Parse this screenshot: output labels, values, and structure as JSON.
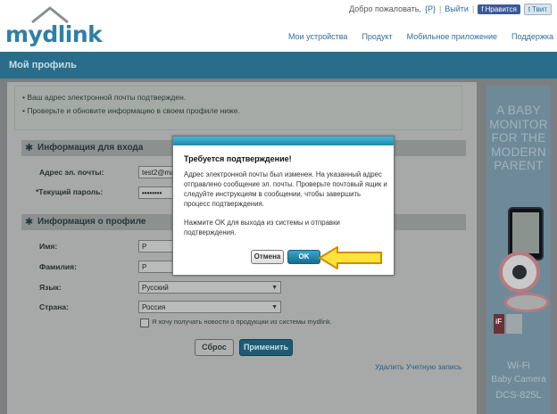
{
  "header": {
    "logo_text": "mydlink",
    "welcome": "Добро пожаловать,",
    "user": "{P}",
    "logout": "Выйти",
    "facebook": "Нравится",
    "twitter": "Твит",
    "nav": [
      "Мои устройства",
      "Продукт",
      "Мобильное приложение",
      "Поддержка"
    ]
  },
  "page": {
    "title": "Мой профиль"
  },
  "notice": {
    "line1": "Ваш адрес электронной почты подтвержден.",
    "line2": "Проверьте и обновите информацию в своем профиле ниже."
  },
  "login_section": {
    "heading": "Информация для входа",
    "email_label": "Адрес эл. почты:",
    "email_value": "test2@ma",
    "password_label": "*Текущий пароль:",
    "password_value": "••••••••"
  },
  "profile_section": {
    "heading": "Информация о профиле",
    "first_name_label": "Имя:",
    "first_name_value": "P",
    "last_name_label": "Фамилия:",
    "last_name_value": "P",
    "language_label": "Язык:",
    "language_value": "Русский",
    "country_label": "Страна:",
    "country_value": "Россия",
    "newsletter_label": "Я хочу получать новости о продукции из системы mydlink."
  },
  "buttons": {
    "reset": "Сброс",
    "apply": "Применить",
    "delete_account": "Удалить Учетную запись"
  },
  "ad": {
    "line1": "A BABY",
    "line2": "MONITOR",
    "line3": "FOR THE",
    "line4": "MODERN",
    "line5": "PARENT",
    "product_line1": "Wi-Fi",
    "product_line2": "Baby Camera",
    "model": "DCS-825L",
    "award": "iF"
  },
  "modal": {
    "title": "Требуется подтверждение!",
    "body": "Адрес электронной почты был изменен. На указанный адрес отправлено сообщение эл. почты. Проверьте почтовый ящик и следуйте инструкциям в сообщении, чтобы завершить процесс подтверждения.",
    "body2": "Нажмите OK для выхода из системы и отправки подтверждения.",
    "cancel": "Отмена",
    "ok": "OK"
  },
  "colors": {
    "brand": "#2f7fa8",
    "band": "#2a6d8a",
    "ok_button": "#1e7fa3",
    "arrow": "#ffe23a"
  }
}
